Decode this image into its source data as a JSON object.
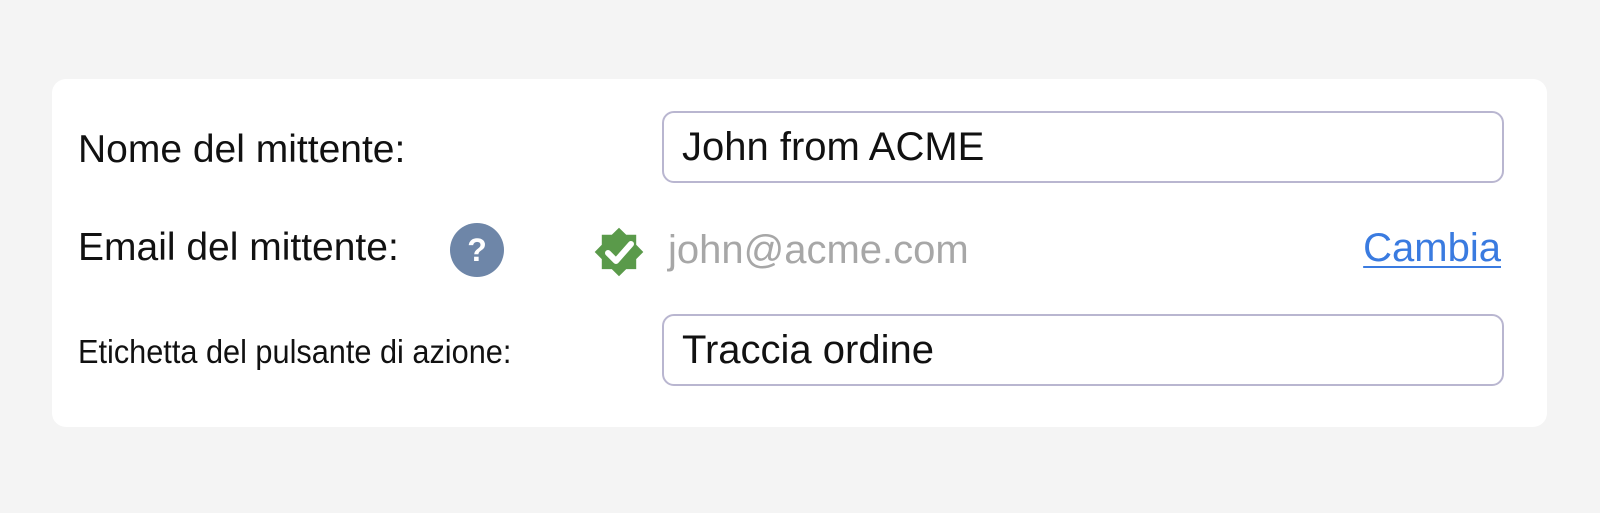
{
  "form": {
    "sender_name": {
      "label": "Nome del mittente:",
      "value": "John from ACME"
    },
    "sender_email": {
      "label": "Email del mittente:",
      "help_icon": "question-mark-icon",
      "help_glyph": "?",
      "verified_icon": "verified-check-badge-icon",
      "value": "john@acme.com",
      "change_label": "Cambia"
    },
    "action_button_label": {
      "label": "Etichetta del pulsante di azione:",
      "value": "Traccia ordine"
    }
  },
  "colors": {
    "page_background": "#f4f4f4",
    "card_background": "#ffffff",
    "field_border": "#b9b6d0",
    "help_icon": "#6e86a8",
    "verified_badge": "#5a9a4a",
    "email_text": "#a7a7a7",
    "link": "#3a7be0"
  }
}
